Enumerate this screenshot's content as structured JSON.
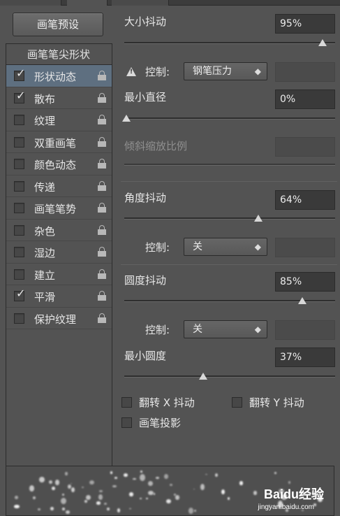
{
  "preset_button": "画笔预设",
  "left_panel": {
    "tip_shape_label": "画笔笔尖形状",
    "options": [
      {
        "label": "形状动态",
        "checked": true,
        "selected": true
      },
      {
        "label": "散布",
        "checked": true,
        "selected": false
      },
      {
        "label": "纹理",
        "checked": false,
        "selected": false
      },
      {
        "label": "双重画笔",
        "checked": false,
        "selected": false
      },
      {
        "label": "颜色动态",
        "checked": false,
        "selected": false
      },
      {
        "label": "传递",
        "checked": false,
        "selected": false
      },
      {
        "label": "画笔笔势",
        "checked": false,
        "selected": false
      },
      {
        "label": "杂色",
        "checked": false,
        "selected": false
      },
      {
        "label": "湿边",
        "checked": false,
        "selected": false
      },
      {
        "label": "建立",
        "checked": false,
        "selected": false
      },
      {
        "label": "平滑",
        "checked": true,
        "selected": false
      },
      {
        "label": "保护纹理",
        "checked": false,
        "selected": false
      }
    ]
  },
  "right_panel": {
    "size_jitter": {
      "label": "大小抖动",
      "value": "95%",
      "level": 0.95
    },
    "control1": {
      "label": "控制:",
      "value": "钢笔压力"
    },
    "min_diameter": {
      "label": "最小直径",
      "value": "0%",
      "level": 0.0
    },
    "tilt_scale": {
      "label": "倾斜缩放比例"
    },
    "angle_jitter": {
      "label": "角度抖动",
      "value": "64%",
      "level": 0.64
    },
    "control2": {
      "label": "控制:",
      "value": "关"
    },
    "roundness_jitter": {
      "label": "圆度抖动",
      "value": "85%",
      "level": 0.85
    },
    "control3": {
      "label": "控制:",
      "value": "关"
    },
    "min_roundness": {
      "label": "最小圆度",
      "value": "37%",
      "level": 0.37
    },
    "flip_x": "翻转 X 抖动",
    "flip_y": "翻转 Y 抖动",
    "brush_projection": "画笔投影"
  },
  "watermark": {
    "text": "Baidu经验",
    "subtext": "jingyan.baidu.com"
  },
  "icons": {
    "lock": "lock-icon",
    "warning": "warning-icon",
    "select_arrow": "updown-arrow-icon"
  }
}
